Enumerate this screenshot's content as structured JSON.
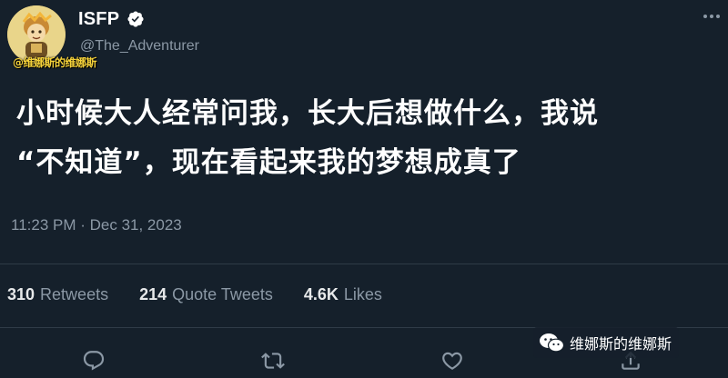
{
  "author": {
    "display_name": "ISFP",
    "handle": "@The_Adventurer",
    "verified": true,
    "avatar_icon": "cartoon-character-avatar"
  },
  "overlay_watermark_top": "@维娜斯的维娜斯",
  "tweet": {
    "text_lines": [
      "小时候大人经常问我，长大后想做什么，我说",
      "“不知道”，现在看起来我的梦想成真了"
    ],
    "timestamp": "11:23 PM · Dec 31, 2023"
  },
  "stats": {
    "retweets": {
      "count": "310",
      "label": "Retweets"
    },
    "quote_tweets": {
      "count": "214",
      "label": "Quote Tweets"
    },
    "likes": {
      "count": "4.6K",
      "label": "Likes"
    }
  },
  "actions": {
    "reply_icon": "reply-icon",
    "retweet_icon": "retweet-icon",
    "like_icon": "heart-icon",
    "share_icon": "share-icon"
  },
  "watermark": {
    "text": "维娜斯的维娜斯",
    "icon": "wechat-icon"
  },
  "colors": {
    "background": "#15202b",
    "primary_text": "#e7e9ea",
    "secondary_text": "#8b98a5",
    "verified": "#1d9bf0",
    "divider": "#2f3b47"
  }
}
